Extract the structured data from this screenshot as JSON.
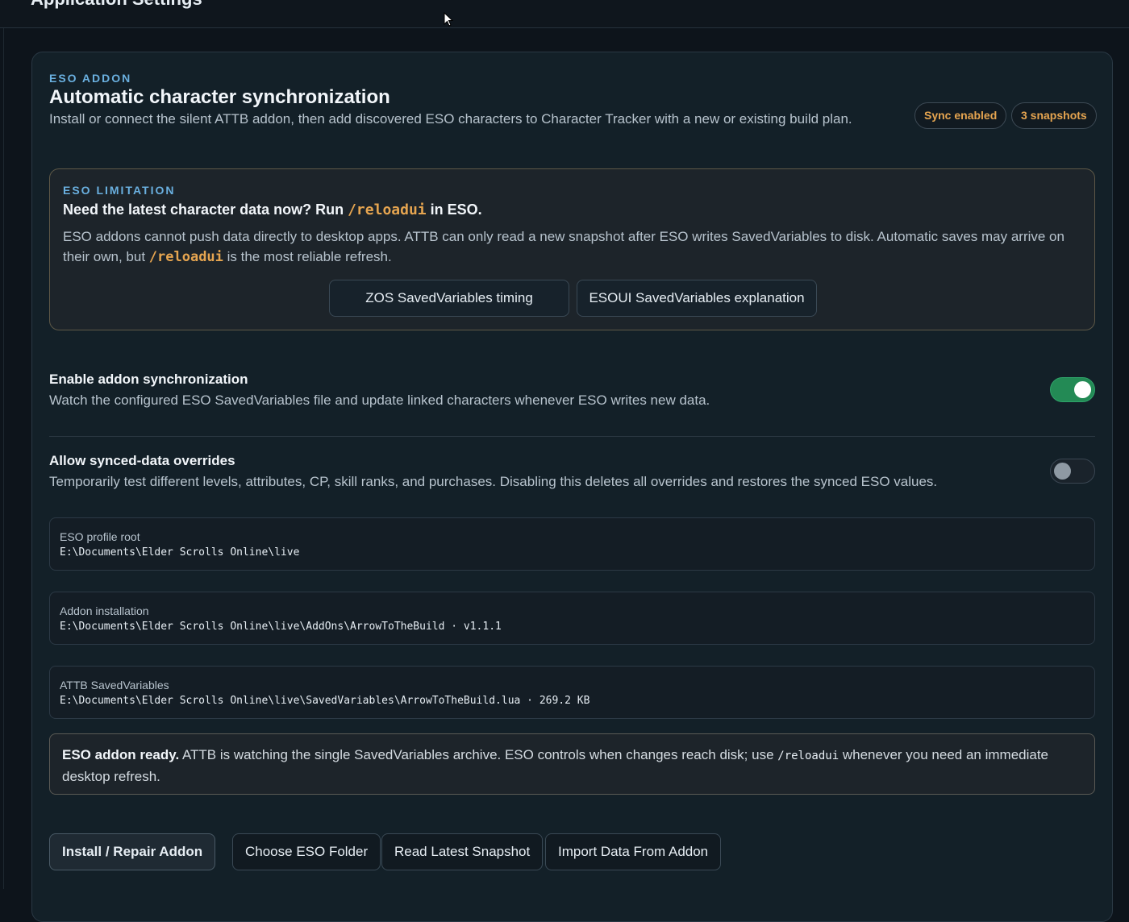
{
  "app": {
    "page_title": "Application Settings"
  },
  "eso_addon": {
    "eyebrow": "ESO ADDON",
    "title": "Automatic character synchronization",
    "subtitle": "Install or connect the silent ATTB addon, then add discovered ESO characters to Character Tracker with a new or existing build plan.",
    "badges": {
      "sync": "Sync enabled",
      "snapshots": "3 snapshots"
    },
    "badge_color": "#e6a550",
    "accent_color": "#6ab0e0"
  },
  "limitation": {
    "eyebrow": "ESO LIMITATION",
    "title_prefix": "Need the latest character data now? Run ",
    "title_code": "/reloadui",
    "title_suffix": " in ESO.",
    "text_1": "ESO addons cannot push data directly to desktop apps. ATTB can only read a new snapshot after ESO writes SavedVariables to disk. Automatic saves may arrive on their own, but ",
    "text_code": "/reloadui",
    "text_2": " is the most reliable refresh.",
    "links": {
      "zos": "ZOS SavedVariables timing",
      "esoui": "ESOUI SavedVariables explanation"
    }
  },
  "settings": {
    "sync": {
      "title": "Enable addon synchronization",
      "description": "Watch the configured ESO SavedVariables file and update linked characters whenever ESO writes new data.",
      "enabled": true
    },
    "overrides": {
      "title": "Allow synced-data overrides",
      "description": "Temporarily test different levels, attributes, CP, skill ranks, and purchases. Disabling this deletes all overrides and restores the synced ESO values.",
      "enabled": false
    },
    "toggle_on_color": "#238a55"
  },
  "paths": {
    "profile_root": {
      "label": "ESO profile root",
      "value": "E:\\Documents\\Elder Scrolls Online\\live"
    },
    "addon_install": {
      "label": "Addon installation",
      "value": "E:\\Documents\\Elder Scrolls Online\\live\\AddOns\\ArrowToTheBuild · v1.1.1"
    },
    "saved_vars": {
      "label": "ATTB SavedVariables",
      "value": "E:\\Documents\\Elder Scrolls Online\\live\\SavedVariables\\ArrowToTheBuild.lua · 269.2 KB"
    }
  },
  "status": {
    "bold": "ESO addon ready.",
    "text_1": " ATTB is watching the single SavedVariables archive. ESO controls when changes reach disk; use ",
    "code": "/reloadui",
    "text_2": " whenever you need an immediate desktop refresh."
  },
  "actions": {
    "install": "Install / Repair Addon",
    "choose_folder": "Choose ESO Folder",
    "read_snapshot": "Read Latest Snapshot",
    "import": "Import Data From Addon"
  }
}
